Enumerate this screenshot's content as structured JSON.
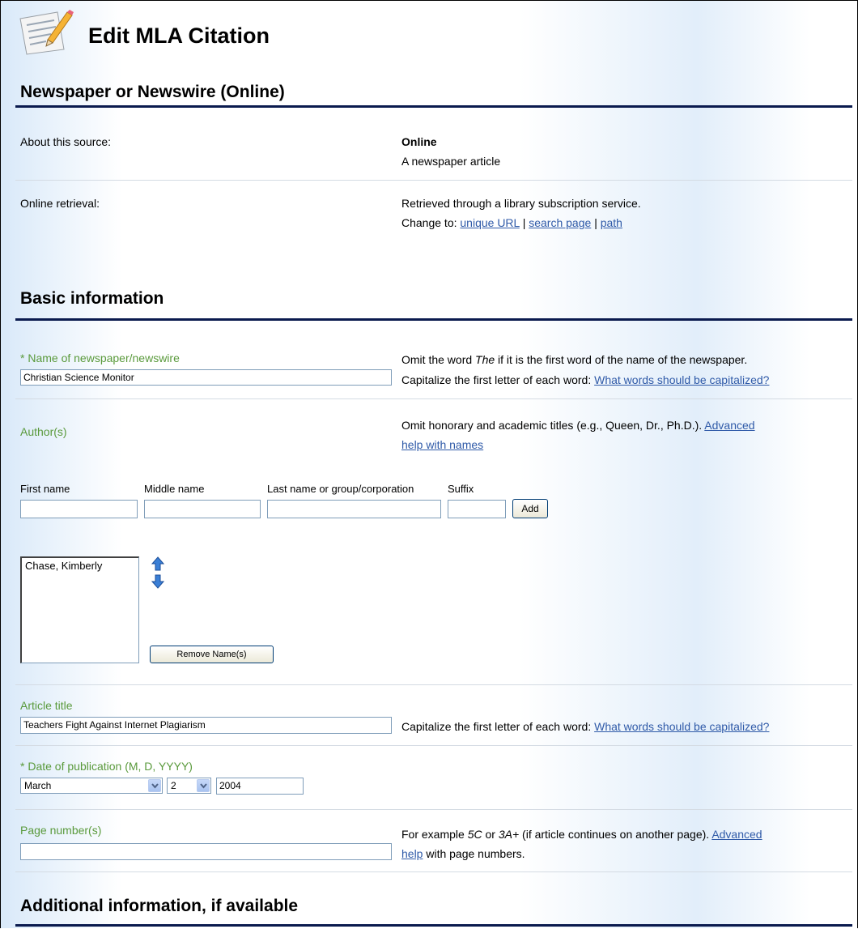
{
  "page": {
    "title": "Edit MLA Citation"
  },
  "source_section": {
    "heading": "Newspaper or Newswire (Online)",
    "about_label": "About this source:",
    "about_value_title": "Online",
    "about_value_desc": "A newspaper article",
    "retrieval_label": "Online retrieval:",
    "retrieval_value": "Retrieved through a library subscription service.",
    "change_to_label": "Change to:",
    "change_links": [
      "unique URL",
      "search page",
      "path"
    ],
    "separator": "|"
  },
  "basic_section": {
    "heading": "Basic information",
    "newspaper": {
      "label": "* Name of newspaper/newswire",
      "value": "Christian Science Monitor",
      "help_line1_pre": "Omit the word ",
      "help_line1_em": "The",
      "help_line1_post": " if it is the first word of the name of the newspaper.",
      "help_line2_pre": "Capitalize the first letter of each word: ",
      "help_line2_link": "What words should be capitalized?"
    },
    "authors": {
      "label": "Author(s)",
      "help_text": "Omit honorary and academic titles (e.g., Queen, Dr., Ph.D.). ",
      "help_link_1": "Advanced",
      "help_link_2": "help with names",
      "first_name_label": "First name",
      "middle_name_label": "Middle name",
      "last_name_label": "Last name or group/corporation",
      "suffix_label": "Suffix",
      "first_name_value": "",
      "middle_name_value": "",
      "last_name_value": "",
      "suffix_value": "",
      "add_button": "Add",
      "list_items": [
        "Chase, Kimberly"
      ],
      "remove_button": "Remove Name(s)"
    },
    "article_title": {
      "label": "Article title",
      "value": "Teachers Fight Against Internet Plagiarism",
      "help_pre": "Capitalize the first letter of each word: ",
      "help_link": "What words should be capitalized?"
    },
    "date": {
      "label": "* Date of publication (M, D, YYYY)",
      "month": "March",
      "day": "2",
      "year": "2004"
    },
    "page_numbers": {
      "label": "Page number(s)",
      "value": "",
      "help_pre": "For example ",
      "help_em1": "5C",
      "help_mid": " or ",
      "help_em2": "3A+",
      "help_post": " (if article continues on another page). ",
      "help_link_1": "Advanced",
      "help_link_2": "help",
      "help_tail": " with page numbers."
    }
  },
  "additional_section": {
    "heading": "Additional information, if available"
  },
  "colors": {
    "label_green": "#5a9a3c",
    "link_blue": "#2f5aa8",
    "rule_navy": "#0a1a4e"
  },
  "icons": {
    "title_icon": "notepad-pencil-icon",
    "up": "arrow-up-icon",
    "down": "arrow-down-icon",
    "dropdown": "chevron-down-icon"
  }
}
